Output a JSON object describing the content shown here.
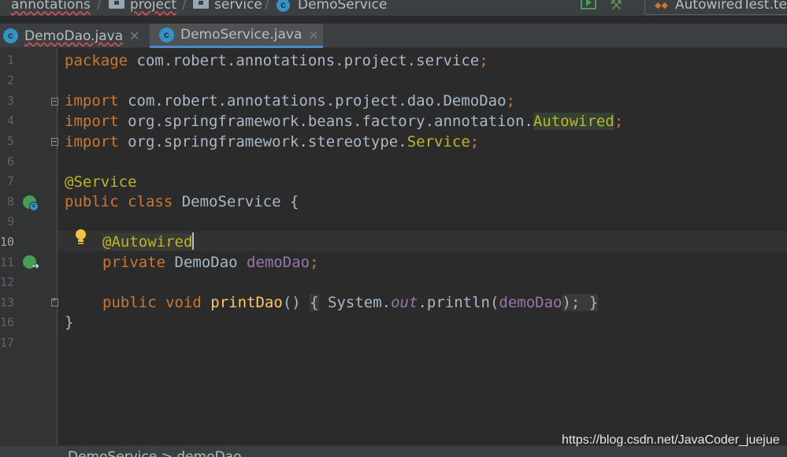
{
  "navbar": {
    "breadcrumbs": [
      "annotations",
      "project",
      "service",
      "DemoService"
    ],
    "run_config_label": "AutowiredTest.te"
  },
  "tabs": [
    {
      "label": "DemoDao.java",
      "active": false,
      "icon": "class-icon"
    },
    {
      "label": "DemoService.java",
      "active": true,
      "icon": "class-icon"
    }
  ],
  "editor": {
    "line_numbers": [
      "1",
      "2",
      "3",
      "4",
      "5",
      "6",
      "7",
      "8",
      "9",
      "10",
      "11",
      "12",
      "13",
      "16",
      "17"
    ],
    "current_line": "10",
    "code": {
      "l1_kw": "package",
      "l1_rest": " com.robert.annotations.project.service",
      "l1_semi": ";",
      "l3_kw": "import",
      "l3_rest": " com.robert.annotations.project.dao.DemoDao",
      "l3_semi": ";",
      "l4_kw": "import",
      "l4_rest": " org.springframework.beans.factory.annotation.",
      "l4_cls": "Autowired",
      "l4_semi": ";",
      "l5_kw": "import",
      "l5_rest": " org.springframework.stereotype.",
      "l5_cls": "Service",
      "l5_semi": ";",
      "l7_ann": "@Service",
      "l8_kw": "public class",
      "l8_rest": " DemoService {",
      "l10_ann": "@Autowired",
      "l11_kw": "private",
      "l11_type": " DemoDao ",
      "l11_field": "demoDao",
      "l11_semi": ";",
      "l13_kw": "public void",
      "l13_method": "printDao",
      "l13_parens": "() ",
      "l13_open": "{",
      "l13_sys": " System.",
      "l13_out": "out",
      "l13_println": ".println(",
      "l13_field": "demoDao",
      "l13_close": ");",
      "l13_end": " }",
      "l16": "}"
    }
  },
  "bottombar": {
    "breadcrumb": "DemoService  >  demoDao"
  },
  "watermark": "https://blog.csdn.net/JavaCoder_juejue",
  "colors": {
    "background": "#2b2b2b",
    "keyword": "#cc7832",
    "annotation": "#bbb529",
    "field": "#9876aa",
    "method": "#ffc66d",
    "active_tab_underline": "#4a88c7"
  }
}
